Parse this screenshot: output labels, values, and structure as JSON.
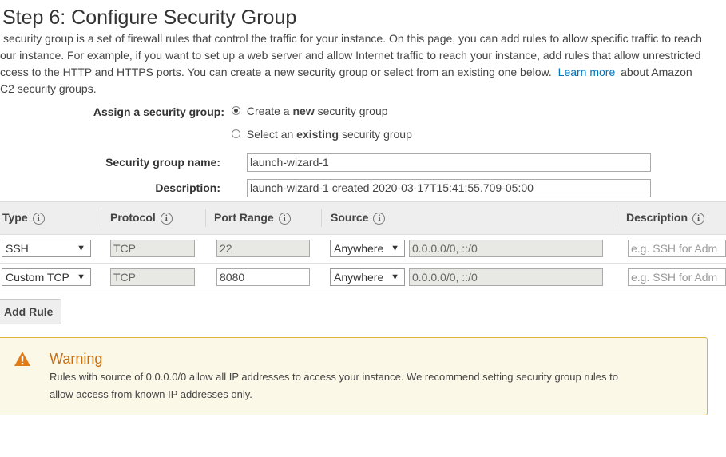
{
  "page": {
    "title": "Step 6: Configure Security Group",
    "intro_lines": [
      "security group is a set of firewall rules that control the traffic for your instance. On this page, you can add rules to allow specific traffic to reach",
      "our instance. For example, if you want to set up a web server and allow Internet traffic to reach your instance, add rules that allow unrestricted",
      "ccess to the HTTP and HTTPS ports. You can create a new security group or select from an existing one below.",
      "C2 security groups."
    ],
    "learn_more": "Learn more",
    "after_link": "about Amazon"
  },
  "assign": {
    "label": "Assign a security group:",
    "option_new": {
      "prefix": "Create a ",
      "bold": "new",
      "suffix": " security group",
      "checked": true
    },
    "option_existing": {
      "prefix": "Select an ",
      "bold": "existing",
      "suffix": " security group",
      "checked": false
    }
  },
  "form": {
    "name_label": "Security group name:",
    "name_value": "launch-wizard-1",
    "description_label": "Description:",
    "description_value": "launch-wizard-1 created 2020-03-17T15:41:55.709-05:00"
  },
  "table": {
    "headers": {
      "type": "Type",
      "protocol": "Protocol",
      "port_range": "Port Range",
      "source": "Source",
      "description": "Description"
    },
    "info_glyph": "i",
    "rows": [
      {
        "type": "SSH",
        "protocol": "TCP",
        "port": "22",
        "source": "Anywhere",
        "cidr": "0.0.0.0/0, ::/0",
        "description_placeholder": "e.g. SSH for Adm"
      },
      {
        "type": "Custom TCP",
        "protocol": "TCP",
        "port": "8080",
        "source": "Anywhere",
        "cidr": "0.0.0.0/0, ::/0",
        "description_placeholder": "e.g. SSH for Adm"
      }
    ],
    "dropdown_glyph": "▼"
  },
  "add_rule_label": "Add Rule",
  "warning": {
    "icon": "warning-triangle-icon",
    "title": "Warning",
    "lines": [
      "Rules with source of 0.0.0.0/0 allow all IP addresses to access your instance. We recommend setting security group rules to",
      "allow access from known IP addresses only."
    ]
  }
}
